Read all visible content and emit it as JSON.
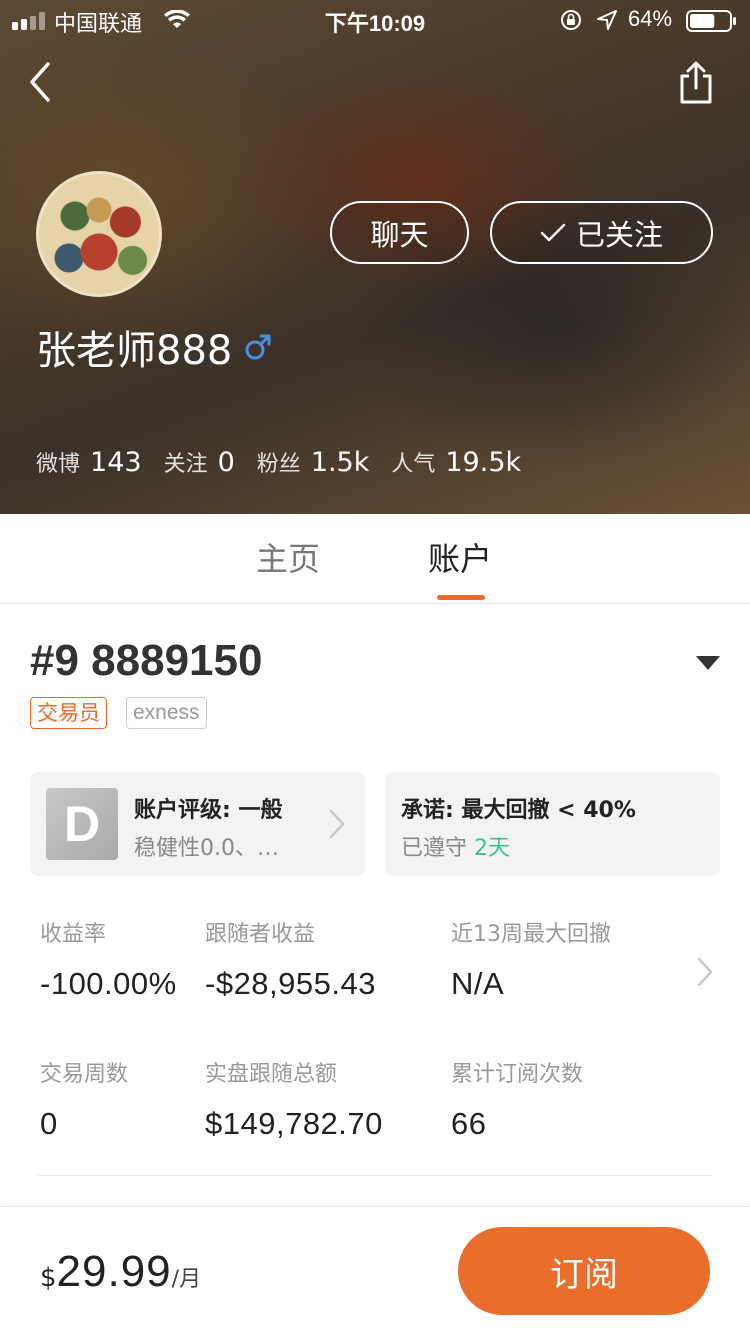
{
  "status_bar": {
    "carrier": "中国联通",
    "time": "下午10:09",
    "battery_pct": "64%",
    "battery_level": 0.64
  },
  "header": {
    "back_icon": "chevron-left-icon",
    "share_icon": "share-icon",
    "chat_label": "聊天",
    "follow_label": "已关注",
    "username": "张老师888",
    "gender": "male",
    "gender_color": "#4a8fe0",
    "stats": [
      {
        "label": "微博",
        "value": "143"
      },
      {
        "label": "关注",
        "value": "0"
      },
      {
        "label": "粉丝",
        "value": "1.5k"
      },
      {
        "label": "人气",
        "value": "19.5k"
      }
    ]
  },
  "tabs": [
    {
      "label": "主页",
      "active": false
    },
    {
      "label": "账户",
      "active": true
    }
  ],
  "account": {
    "number": "#9 8889150",
    "tags": [
      "交易员",
      "exness"
    ],
    "rating_card": {
      "badge": "D",
      "title": "账户评级: 一般",
      "subtitle": "稳健性0.0、…"
    },
    "promise_card": {
      "title": "承诺: 最大回撤 < 40%",
      "subtitle_prefix": "已遵守",
      "subtitle_days": "2天"
    },
    "metrics": [
      {
        "label": "收益率",
        "value": "-100.00%"
      },
      {
        "label": "跟随者收益",
        "value": "-$28,955.43"
      },
      {
        "label": "近13周最大回撤",
        "value": "N/A"
      },
      {
        "label": "交易周数",
        "value": "0"
      },
      {
        "label": "实盘跟随总额",
        "value": "$149,782.70"
      },
      {
        "label": "累计订阅次数",
        "value": "66"
      }
    ]
  },
  "bottom": {
    "currency": "$",
    "amount": "29.99",
    "unit": "/月",
    "subscribe_label": "订阅"
  },
  "colors": {
    "accent": "#ea6d2c",
    "green": "#37c29a"
  }
}
